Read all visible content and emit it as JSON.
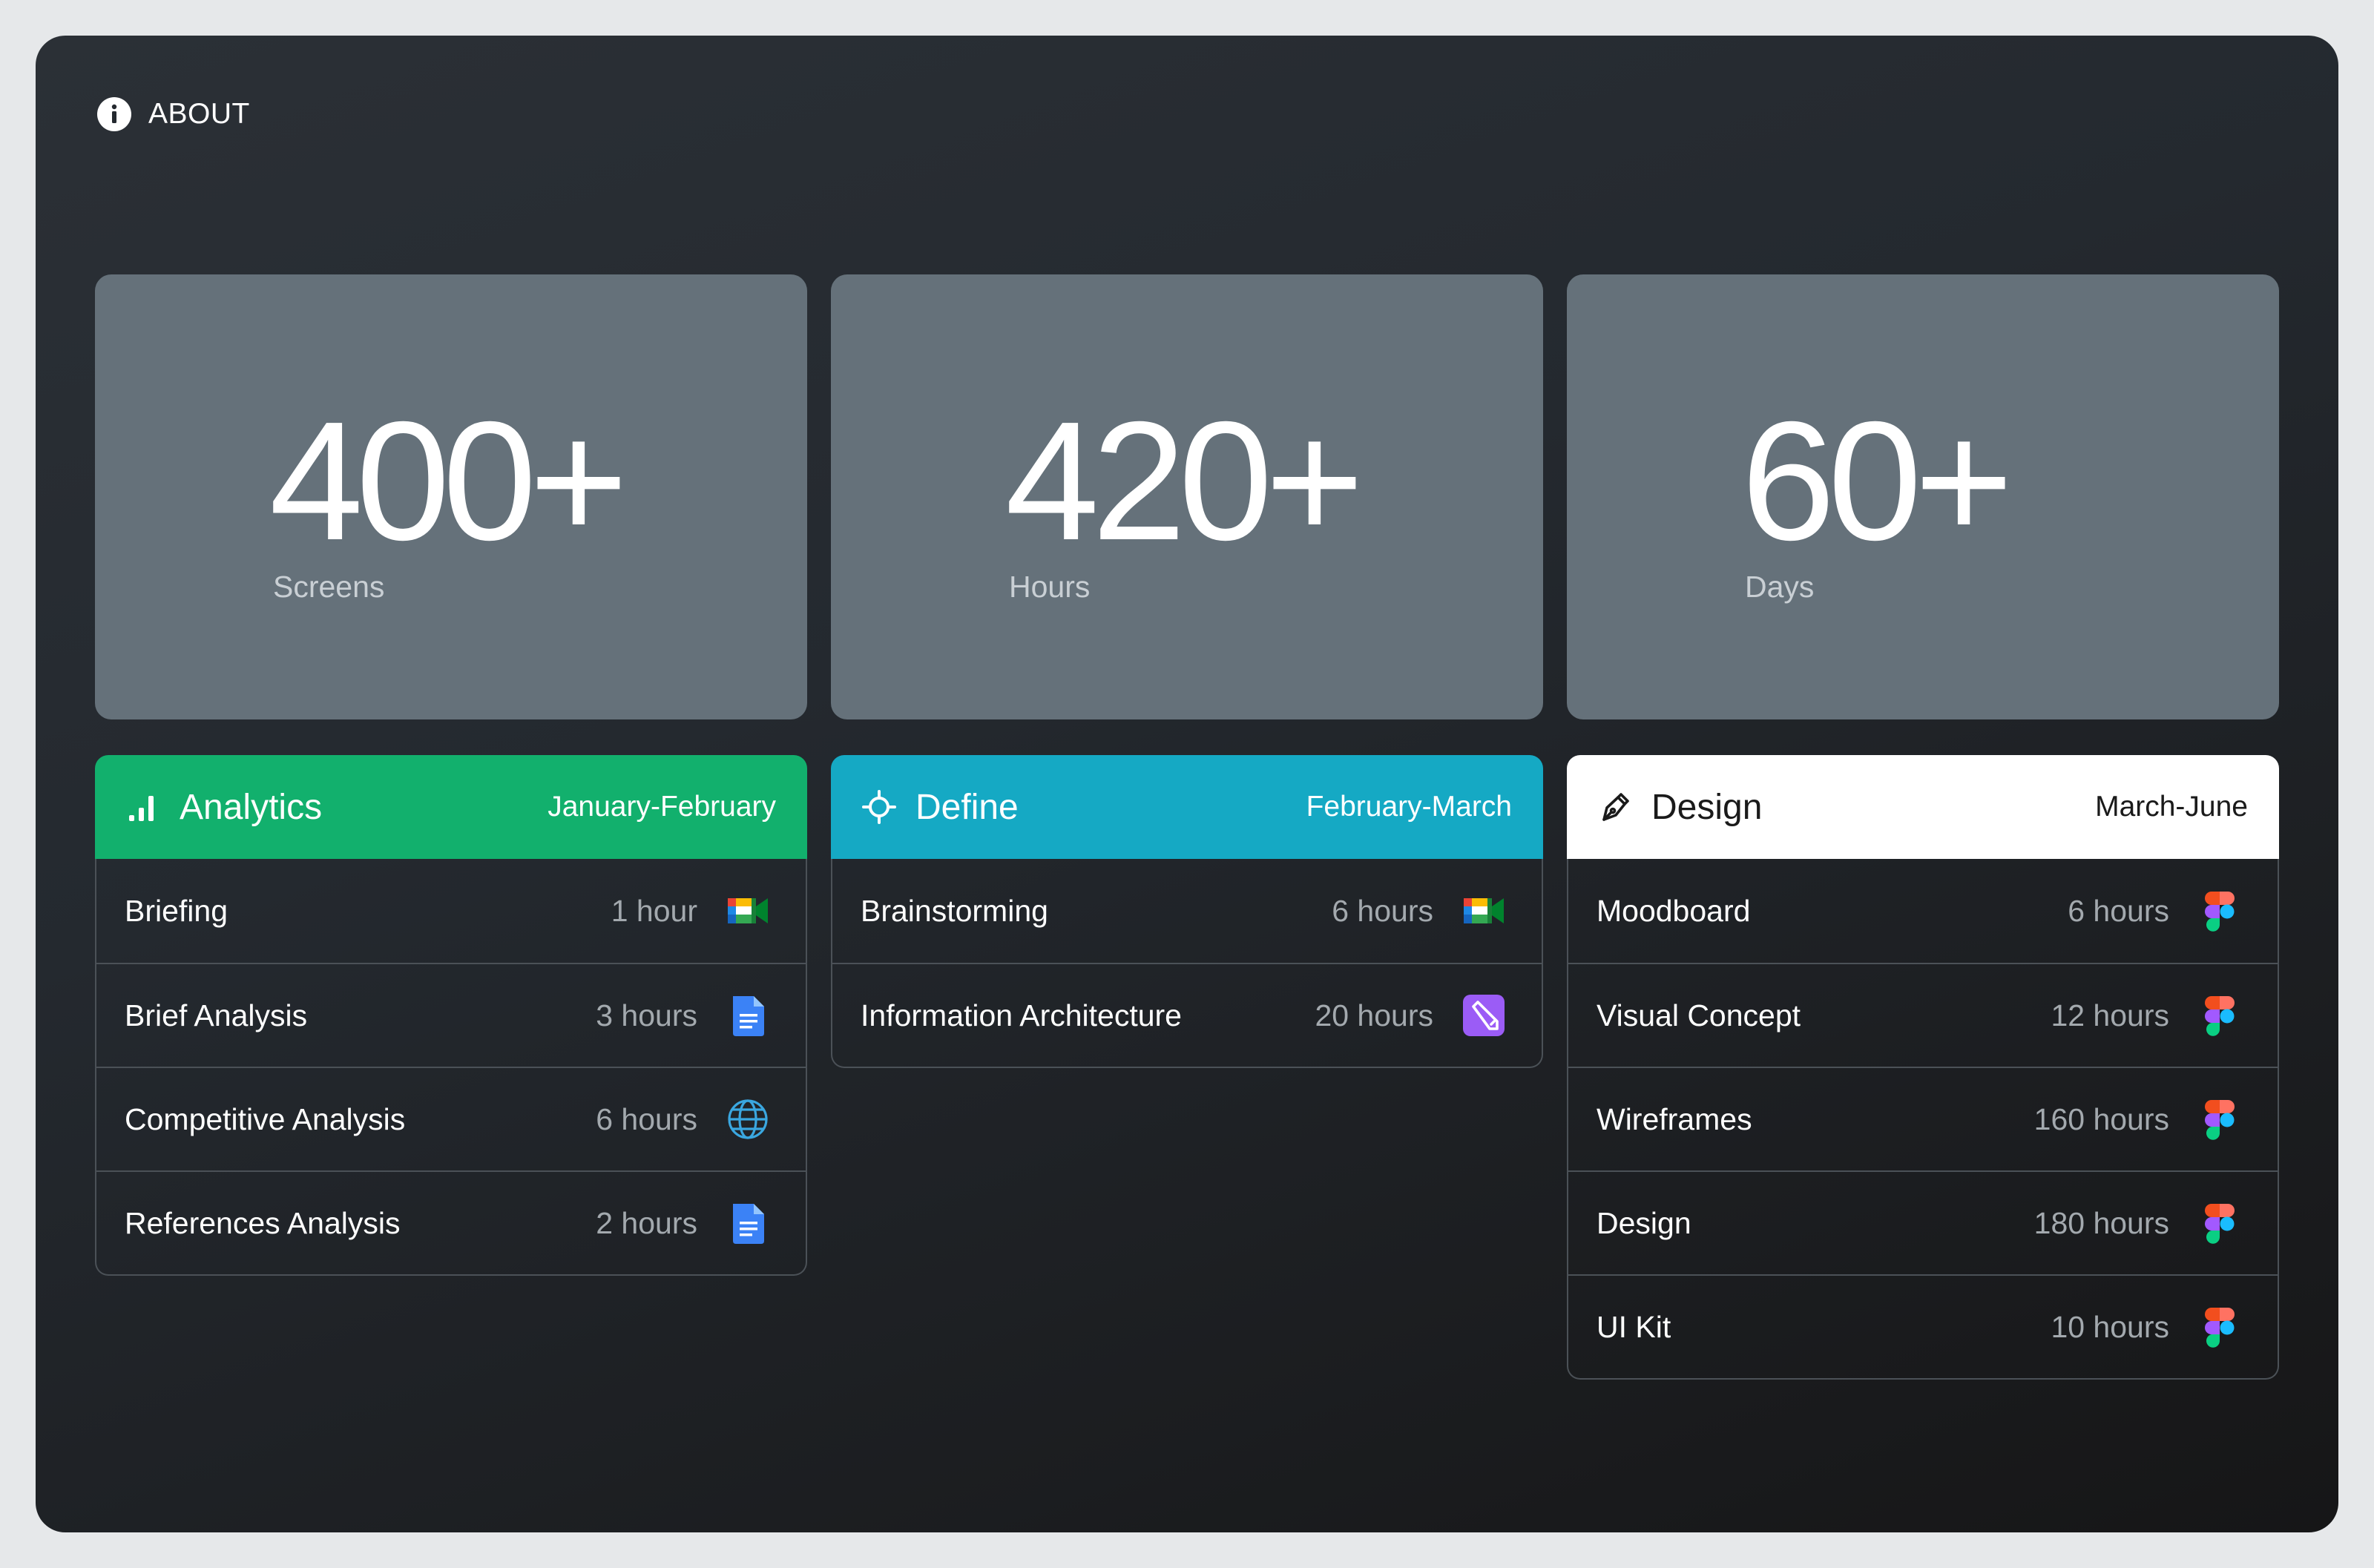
{
  "header": {
    "about_label": "ABOUT",
    "icon": "info-circle-icon"
  },
  "stats": [
    {
      "value": "400+",
      "label": "Screens"
    },
    {
      "value": "420+",
      "label": "Hours"
    },
    {
      "value": "60+",
      "label": "Days"
    }
  ],
  "phases": [
    {
      "title": "Analytics",
      "range": "January-February",
      "icon": "bar-chart-icon",
      "color": "#12b06d",
      "tasks": [
        {
          "name": "Briefing",
          "hours": "1 hour",
          "tool": "google-meet-icon"
        },
        {
          "name": "Brief Analysis",
          "hours": "3 hours",
          "tool": "google-docs-icon"
        },
        {
          "name": "Competitive Analysis",
          "hours": "6 hours",
          "tool": "globe-icon"
        },
        {
          "name": "References Analysis",
          "hours": "2 hours",
          "tool": "google-docs-icon"
        }
      ]
    },
    {
      "title": "Define",
      "range": "February-March",
      "icon": "crosshair-icon",
      "color": "#15a9c4",
      "tasks": [
        {
          "name": "Brainstorming",
          "hours": "6 hours",
          "tool": "google-meet-icon"
        },
        {
          "name": "Information Architecture",
          "hours": "20 hours",
          "tool": "pencil-app-icon"
        }
      ]
    },
    {
      "title": "Design",
      "range": "March-June",
      "icon": "pen-tool-icon",
      "color": "#ffffff",
      "tasks": [
        {
          "name": "Moodboard",
          "hours": "6 hours",
          "tool": "figma-icon"
        },
        {
          "name": "Visual Concept",
          "hours": "12 hours",
          "tool": "figma-icon"
        },
        {
          "name": "Wireframes",
          "hours": "160 hours",
          "tool": "figma-icon"
        },
        {
          "name": "Design",
          "hours": "180 hours",
          "tool": "figma-icon"
        },
        {
          "name": "UI Kit",
          "hours": "10 hours",
          "tool": "figma-icon"
        }
      ]
    }
  ]
}
